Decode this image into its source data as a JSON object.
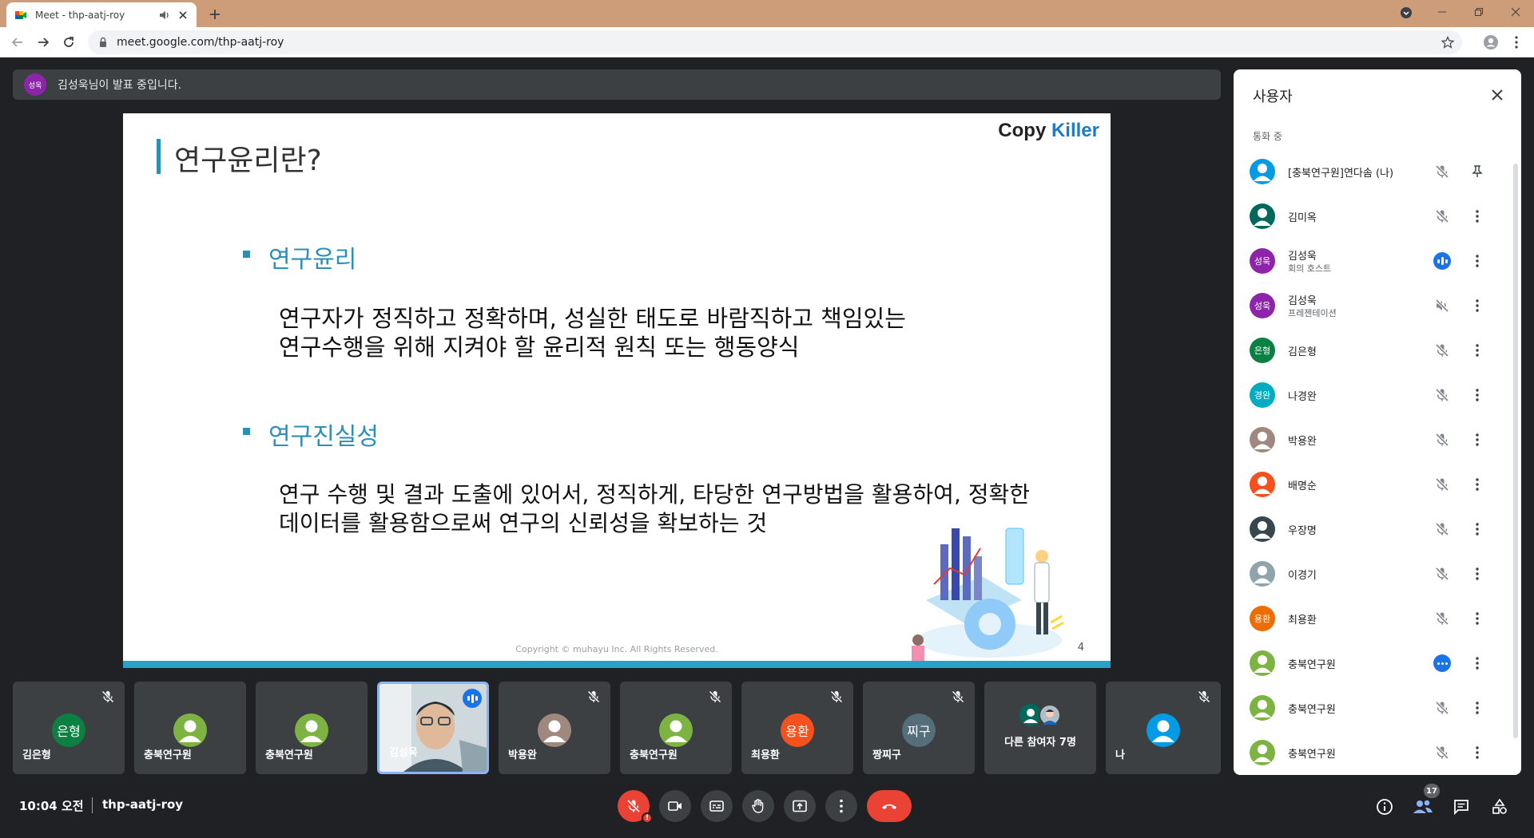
{
  "browser": {
    "tab_title": "Meet - thp-aatj-roy",
    "url": "meet.google.com/thp-aatj-roy"
  },
  "presenter_banner": {
    "avatar_text": "성욱",
    "text": "김성욱님이 발표 중입니다."
  },
  "slide": {
    "title": "연구윤리란?",
    "logo_part1": "Copy ",
    "logo_part2": "Killer",
    "section1_heading": "연구윤리",
    "section1_line1": "연구자가 정직하고 정확하며, 성실한 태도로 바람직하고 책임있는",
    "section1_line2": "연구수행을 위해 지켜야 할 윤리적 원칙 또는 행동양식",
    "section2_heading": "연구진실성",
    "section2_line1": "연구 수행 및 결과 도출에 있어서, 정직하게, 타당한 연구방법을 활용하여, 정확한",
    "section2_line2": "데이터를  활용함으로써 연구의 신뢰성을 확보하는 것",
    "copyright": "Copyright © muhayu Inc. All Rights Reserved.",
    "page_number": "4"
  },
  "tiles": [
    {
      "name": "김은형",
      "initials": "은형",
      "color": "#0b8043"
    },
    {
      "name": "충북연구원",
      "initials": "",
      "color": "#7cb342"
    },
    {
      "name": "충북연구원",
      "initials": "",
      "color": "#7cb342"
    },
    {
      "name": "김성욱",
      "initials": "",
      "color": "#55606b"
    },
    {
      "name": "박용완",
      "initials": "",
      "color": "#a1887f"
    },
    {
      "name": "충북연구원",
      "initials": "",
      "color": "#7cb342"
    },
    {
      "name": "최용환",
      "initials": "용환",
      "color": "#f4511e"
    },
    {
      "name": "짱찌구",
      "initials": "찌구",
      "color": "#546e7a"
    },
    {
      "name": "다른 참여자 7명",
      "initials": "",
      "color": "#3c4043"
    },
    {
      "name": "나",
      "initials": "",
      "color": "#039be5"
    }
  ],
  "footer": {
    "time": "10:04 오전",
    "meeting_code": "thp-aatj-roy",
    "people_count": "17"
  },
  "panel": {
    "title": "사용자",
    "subtitle": "통화 중",
    "people": [
      {
        "name": "[충북연구원]연다솜 (나)",
        "sub": "",
        "initials": "",
        "color": "#039be5",
        "status": "muted",
        "action": "pin"
      },
      {
        "name": "김미옥",
        "sub": "",
        "initials": "",
        "color": "#00695c",
        "status": "muted",
        "action": "more"
      },
      {
        "name": "김성욱",
        "sub": "회의 호스트",
        "initials": "성욱",
        "color": "#8e24aa",
        "status": "speaking",
        "action": "more"
      },
      {
        "name": "김성욱",
        "sub": "프레젠테이션",
        "initials": "성욱",
        "color": "#8e24aa",
        "status": "audio-off",
        "action": "more"
      },
      {
        "name": "김은형",
        "sub": "",
        "initials": "은형",
        "color": "#0b8043",
        "status": "muted",
        "action": "more"
      },
      {
        "name": "나경완",
        "sub": "",
        "initials": "경완",
        "color": "#00acc1",
        "status": "muted",
        "action": "more"
      },
      {
        "name": "박용완",
        "sub": "",
        "initials": "",
        "color": "#a1887f",
        "status": "muted",
        "action": "more"
      },
      {
        "name": "배명순",
        "sub": "",
        "initials": "",
        "color": "#f4511e",
        "status": "muted",
        "action": "more"
      },
      {
        "name": "우장명",
        "sub": "",
        "initials": "",
        "color": "#37474f",
        "status": "muted",
        "action": "more"
      },
      {
        "name": "이경기",
        "sub": "",
        "initials": "",
        "color": "#90a4ae",
        "status": "muted",
        "action": "more"
      },
      {
        "name": "최용환",
        "sub": "",
        "initials": "용환",
        "color": "#ef6c00",
        "status": "muted",
        "action": "more"
      },
      {
        "name": "충북연구원",
        "sub": "",
        "initials": "",
        "color": "#7cb342",
        "status": "dots",
        "action": "more"
      },
      {
        "name": "충북연구원",
        "sub": "",
        "initials": "",
        "color": "#7cb342",
        "status": "muted",
        "action": "more"
      },
      {
        "name": "충북연구원",
        "sub": "",
        "initials": "",
        "color": "#7cb342",
        "status": "muted",
        "action": "more"
      }
    ]
  }
}
